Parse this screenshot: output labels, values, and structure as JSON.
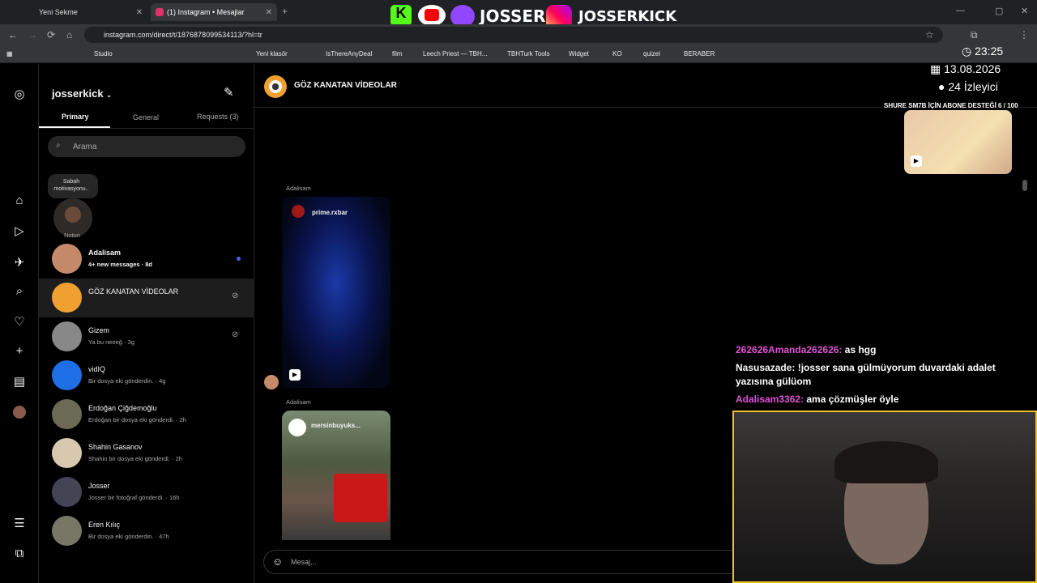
{
  "browser": {
    "tabs": [
      {
        "label": "Yeni Sekme"
      },
      {
        "label": "(1) Instagram • Mesajlar"
      }
    ],
    "url": "instagram.com/direct/t/1876878099534113/?hl=tr",
    "bookmarks": [
      "Studio",
      "Yeni klasör",
      "IsThereAnyDeal",
      "film",
      "Leech Priest — TBH...",
      "TBHTurk Tools",
      "Widget",
      "KO",
      "quizei",
      "BERABER"
    ]
  },
  "stream": {
    "brand1": "JOSSER",
    "brand2": "JOSSERKICK",
    "time": "23:25",
    "date": "13.08.2026",
    "viewers": "24 İzleyici",
    "goal": "SHURE SM7B İÇİN ABONE DESTEĞİ 6 / 100",
    "chat": [
      {
        "user": "262626Amanda262626:",
        "msg": " as hgg",
        "color": "#e052d6"
      },
      {
        "user": "Nasusazade:",
        "msg": " !josser sana gülmüyorum duvardaki adalet yazısına gülüom",
        "color": "#f5f5f5"
      },
      {
        "user": "Adalisam3362:",
        "msg": " ama çözmüşler öyle",
        "color": "#e052d6"
      }
    ]
  },
  "ig": {
    "username": "josserkick",
    "tabs": [
      "Primary",
      "General",
      "Requests (3)"
    ],
    "search_placeholder": "Arama",
    "note_bubble": "Sabah motivasyonu..",
    "note_label": "Notun",
    "conversations": [
      {
        "name": "Adalisam",
        "sub": "4+ new messages · 8d",
        "bold": true,
        "color": "#c48a6a"
      },
      {
        "name": "GÖZ KANATAN VİDEOLAR",
        "sub": "",
        "color": "#f0a030"
      },
      {
        "name": "Gizem",
        "sub": "Ya bu neeeğ · 3g",
        "color": "#888"
      },
      {
        "name": "vidIQ",
        "sub": "Bir dosya eki gönderdin. · 4g",
        "color": "#1e6ee6"
      },
      {
        "name": "Erdoğan Çiğdemoğlu",
        "sub": "Erdoğan bir dosya eki gönderdi. · 2h",
        "color": "#6b6b55"
      },
      {
        "name": "Shahin Gasanov",
        "sub": "Shahin bir dosya eki gönderdi. · 2h",
        "color": "#d8c8b0"
      },
      {
        "name": "Josser",
        "sub": "Josser bir fotoğraf gönderdi. · 16h",
        "color": "#445"
      },
      {
        "name": "Eren Kılıç",
        "sub": "Bir dosya eki gönderdin. · 47h",
        "color": "#776"
      }
    ],
    "chat_title": "GÖZ KANATAN VİDEOLAR",
    "messages": [
      {
        "sender": "Adalisam",
        "account": "prime.rxbar"
      },
      {
        "sender": "Adalisam",
        "account": "mersinbuyuks..."
      }
    ],
    "composer_placeholder": "Mesaj..."
  }
}
